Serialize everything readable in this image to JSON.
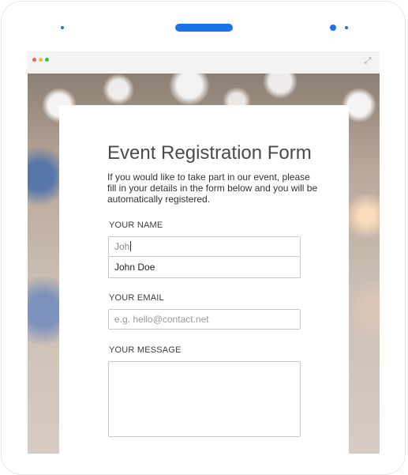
{
  "window": {
    "traffic_lights": {
      "close": "#ff5f57",
      "minimize": "#febc2e",
      "maximize": "#28c840"
    },
    "expand_icon": "expand-icon"
  },
  "form": {
    "title": "Event Registration Form",
    "intro": "If you would like to take part in our event, please fill in your details in the form below and you will be automatically registered.",
    "name": {
      "label": "YOUR NAME",
      "value": "Joh",
      "suggestion": "John Doe"
    },
    "email": {
      "label": "YOUR EMAIL",
      "placeholder": "e.g. hello@contact.net"
    },
    "message": {
      "label": "YOUR MESSAGE"
    }
  },
  "colors": {
    "accent": "#1a73e8"
  }
}
